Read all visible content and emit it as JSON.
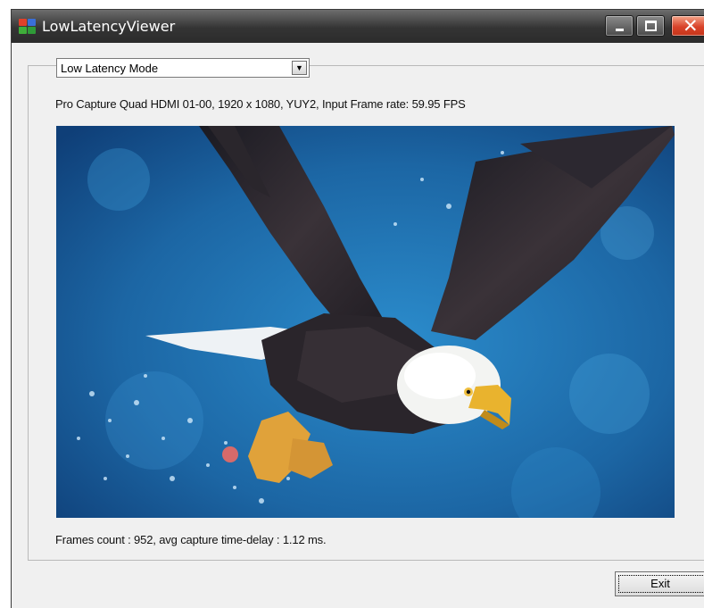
{
  "window": {
    "title": "LowLatencyViewer",
    "close_glyph": "✕",
    "icon": "app-logo-icon"
  },
  "mode_select": {
    "selected": "Low Latency Mode",
    "arrow": "▼"
  },
  "device_info": "Pro Capture Quad HDMI 01-00, 1920 x 1080, YUY2, Input Frame rate: 59.95 FPS",
  "frames_info": "Frames count : 952, avg capture time-delay : 1.12 ms.",
  "exit_button": "Exit",
  "colors": {
    "titlebar": "#343434",
    "close_button": "#d9432a",
    "window_bg": "#f0f0f0",
    "video_water": "#1d6aa6"
  }
}
